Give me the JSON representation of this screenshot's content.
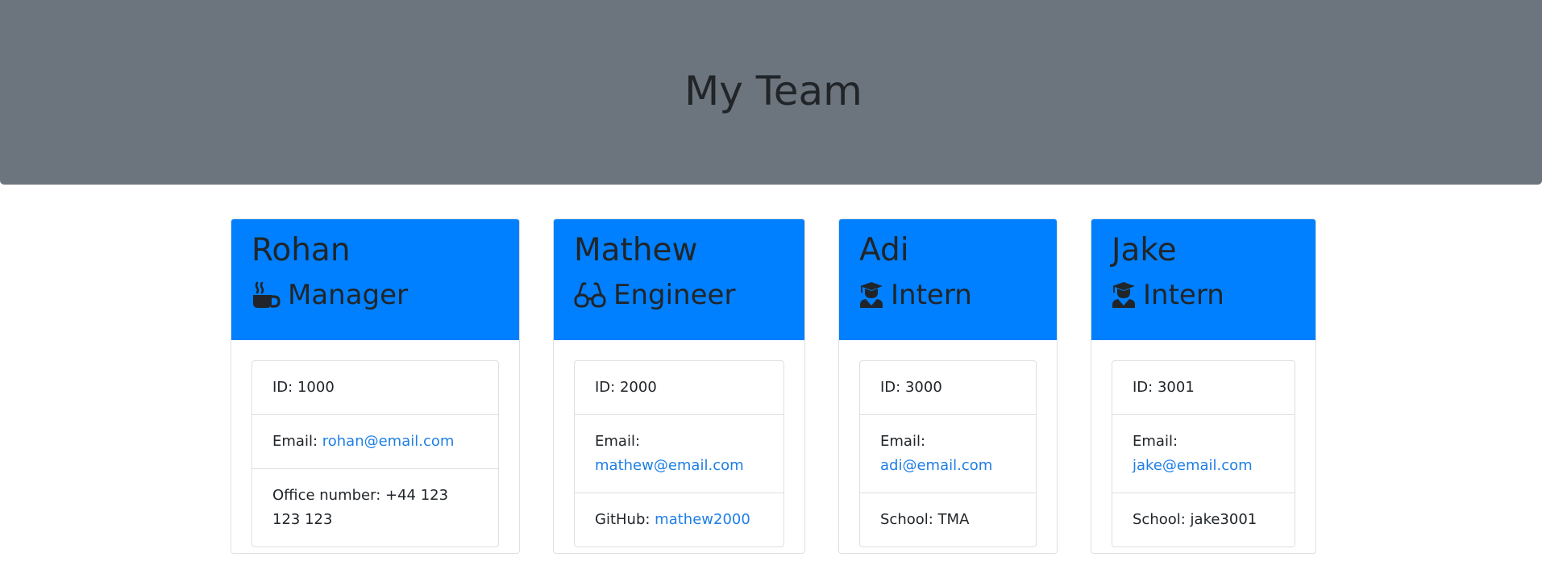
{
  "header": {
    "title": "My Team"
  },
  "colors": {
    "jumbotron": "#6c757d",
    "card_header": "#0080ff",
    "link": "#1e7fe6"
  },
  "team": [
    {
      "name": "Rohan",
      "role": "Manager",
      "role_icon": "coffee-icon",
      "id_label": "ID: ",
      "id": "1000",
      "email_label": "Email: ",
      "email": "rohan@email.com",
      "extra_label": "Office number: ",
      "extra_value": "+44 123 123 123",
      "extra_is_link": false
    },
    {
      "name": "Mathew",
      "role": "Engineer",
      "role_icon": "glasses-icon",
      "id_label": "ID: ",
      "id": "2000",
      "email_label": "Email: ",
      "email": "mathew@email.com",
      "extra_label": "GitHub: ",
      "extra_value": "mathew2000",
      "extra_is_link": true
    },
    {
      "name": "Adi",
      "role": "Intern",
      "role_icon": "graduate-icon",
      "id_label": "ID: ",
      "id": "3000",
      "email_label": "Email: ",
      "email": "adi@email.com",
      "extra_label": "School: ",
      "extra_value": "TMA",
      "extra_is_link": false
    },
    {
      "name": "Jake",
      "role": "Intern",
      "role_icon": "graduate-icon",
      "id_label": "ID: ",
      "id": "3001",
      "email_label": "Email: ",
      "email": "jake@email.com",
      "extra_label": "School: ",
      "extra_value": "jake3001",
      "extra_is_link": false
    }
  ]
}
